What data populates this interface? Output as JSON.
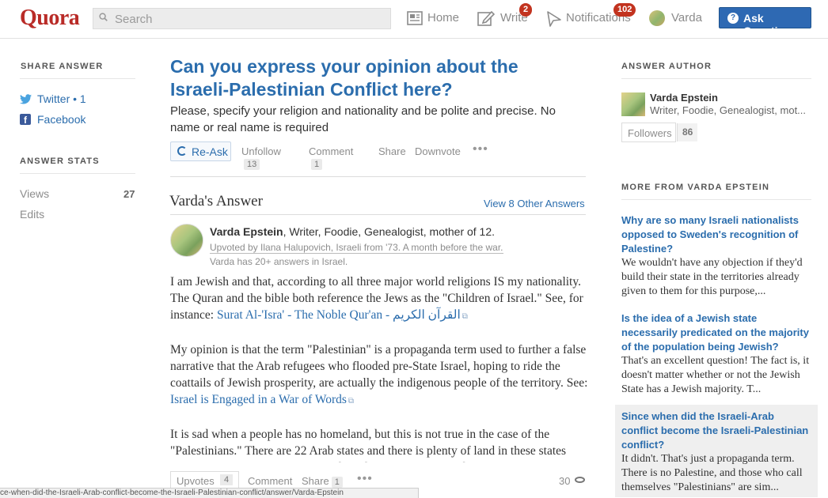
{
  "header": {
    "logo": "Quora",
    "search_placeholder": "Search",
    "nav": [
      {
        "label": "Home"
      },
      {
        "label": "Write",
        "badge": "2"
      },
      {
        "label": "Notifications",
        "badge": "102"
      },
      {
        "label": "Varda"
      }
    ],
    "ask_button": "Ask Question"
  },
  "left": {
    "share_title": "SHARE ANSWER",
    "twitter": "Twitter • 1",
    "facebook": "Facebook",
    "stats_title": "ANSWER STATS",
    "views_label": "Views",
    "views_value": "27",
    "edits_label": "Edits"
  },
  "question": {
    "title": "Can you express your opinion about the Israeli-Palestinian Conflict here?",
    "details": "Please, specify your religion and nationality and be polite and precise. No name or real name is required",
    "reask": "Re-Ask",
    "unfollow": "Unfollow",
    "unfollow_count": "13",
    "comment": "Comment",
    "comment_count": "1",
    "share": "Share",
    "downvote": "Downvote",
    "more": "•••"
  },
  "answer": {
    "heading": "Varda's Answer",
    "other_answers": "View 8 Other Answers",
    "author_name": "Varda Epstein",
    "author_desc": ", Writer, Foodie, Genealogist, mother of 12.",
    "upvoted_by": "Upvoted by Ilana Halupovich, Israeli from '73. A month before the war.",
    "answers_in": "Varda has 20+ answers in Israel.",
    "p1_text": "I am Jewish and that, according to all three major world religions IS my nationality. The Quran and the bible both reference the Jews as the \"Children of Israel.\" See, for instance: ",
    "p1_link": "Surat Al-'Isra' - The Noble Qur'an - القرآن الكريم",
    "p2_text": "My opinion is that the term \"Palestinian\" is a propaganda term used to further a false narrative that the Arab refugees who flooded pre-State Israel, hoping to ride the coattails of Jewish prosperity, are actually the indigenous people of the territory. See: ",
    "p2_link": "Israel is Engaged in a War of Words",
    "p3_text": "It is sad when a people has no homeland, but this is not true in the case of the \"Palestinians.\" There are 22  Arab states and there is plenty of land in these states where these \"refugees\" might reside and call their homeland, were these",
    "upvotes": "Upvotes",
    "upvotes_count": "4",
    "comment": "Comment",
    "share": "Share",
    "share_count": "1",
    "more": "•••",
    "views": "30"
  },
  "status_url": "ce-when-did-the-Israeli-Arab-conflict-become-the-Israeli-Palestinian-conflict/answer/Varda-Epstein",
  "right": {
    "author_title": "ANSWER AUTHOR",
    "name": "Varda Epstein",
    "desc": "Writer, Foodie, Genealogist, mot...",
    "followers": "Followers",
    "followers_count": "86",
    "more_title": "MORE FROM VARDA EPSTEIN",
    "related": [
      {
        "title": "Why are so many Israeli nationalists opposed to Sweden's recognition of Palestine?",
        "snippet": "We wouldn't have any objection if they'd build their state in the territories already given to them for this purpose,..."
      },
      {
        "title": "Is the idea of a Jewish state necessarily predicated on the majority of the population being Jewish?",
        "snippet": "That's an excellent question! The fact is, it doesn't matter whether or not the Jewish State has a Jewish majority. T..."
      },
      {
        "title": "Since when did the Israeli-Arab conflict become the Israeli-Palestinian conflict?",
        "snippet": "It didn't. That's just a propaganda term. There is no Palestine, and those who call themselves \"Palestinians\" are sim..."
      }
    ]
  },
  "colors": {
    "brand": "#b92b27",
    "link": "#2b6dad",
    "badge": "#c2331f",
    "ask_button": "#2e69b3"
  }
}
